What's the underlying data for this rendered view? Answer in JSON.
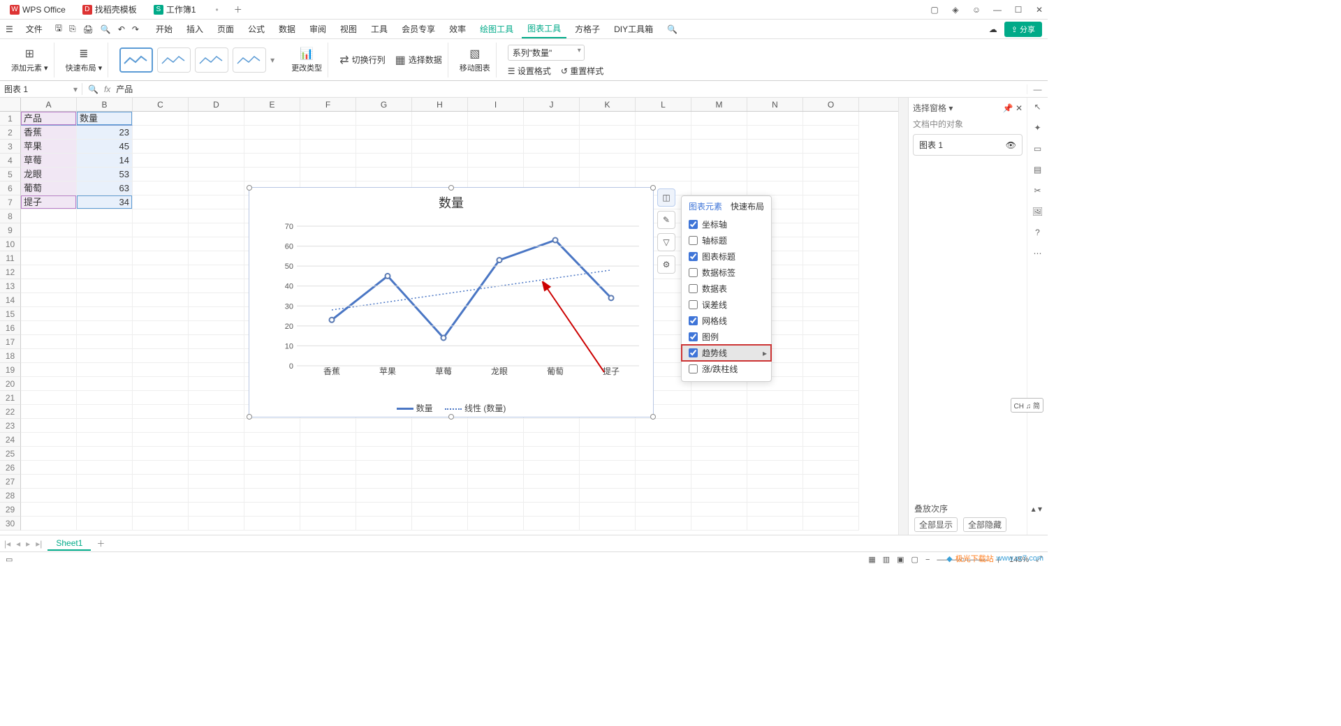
{
  "titlebar": {
    "tabs": [
      {
        "icon_bg": "#d33",
        "icon_txt": "W",
        "label": "WPS Office"
      },
      {
        "icon_bg": "#d33",
        "icon_txt": "D",
        "label": "找稻壳模板"
      },
      {
        "icon_bg": "#0a8",
        "icon_txt": "S",
        "label": "工作簿1"
      }
    ]
  },
  "menubar": {
    "file": "文件",
    "items": [
      "开始",
      "插入",
      "页面",
      "公式",
      "数据",
      "审阅",
      "视图",
      "工具",
      "会员专享",
      "效率",
      "绘图工具",
      "图表工具",
      "方格子",
      "DIY工具箱"
    ],
    "active": "图表工具",
    "green_extra": "绘图工具",
    "share": "分享"
  },
  "ribbon": {
    "add_element": "添加元素",
    "quick_layout": "快速布局",
    "change_type": "更改类型",
    "switch_rc": "切换行列",
    "select_data": "选择数据",
    "move_chart": "移动图表",
    "series_label": "系列\"数量\"",
    "set_format": "设置格式",
    "reset_style": "重置样式"
  },
  "namebox": "图表 1",
  "formula": "产品",
  "columns": [
    "A",
    "B",
    "C",
    "D",
    "E",
    "F",
    "G",
    "H",
    "I",
    "J",
    "K",
    "L",
    "M",
    "N",
    "O"
  ],
  "data": {
    "headers": [
      "产品",
      "数量"
    ],
    "rows": [
      [
        "香蕉",
        23
      ],
      [
        "苹果",
        45
      ],
      [
        "草莓",
        14
      ],
      [
        "龙眼",
        53
      ],
      [
        "葡萄",
        63
      ],
      [
        "提子",
        34
      ]
    ]
  },
  "chart_data": {
    "type": "line",
    "title": "数量",
    "categories": [
      "香蕉",
      "苹果",
      "草莓",
      "龙眼",
      "葡萄",
      "提子"
    ],
    "series": [
      {
        "name": "数量",
        "values": [
          23,
          45,
          14,
          53,
          63,
          34
        ],
        "style": "solid"
      },
      {
        "name": "线性 (数量)",
        "values": [
          28,
          32,
          36,
          40,
          44,
          48
        ],
        "style": "dotted",
        "is_trendline": true
      }
    ],
    "ylim": [
      0,
      70
    ],
    "ytick": 10,
    "legend": {
      "series": "数量",
      "trend": "线性 (数量)"
    }
  },
  "popup": {
    "tab_elements": "图表元素",
    "tab_layout": "快速布局",
    "items": [
      {
        "label": "坐标轴",
        "checked": true
      },
      {
        "label": "轴标题",
        "checked": false
      },
      {
        "label": "图表标题",
        "checked": true
      },
      {
        "label": "数据标签",
        "checked": false
      },
      {
        "label": "数据表",
        "checked": false
      },
      {
        "label": "误差线",
        "checked": false
      },
      {
        "label": "网格线",
        "checked": true
      },
      {
        "label": "图例",
        "checked": true
      },
      {
        "label": "趋势线",
        "checked": true,
        "highlight": true
      },
      {
        "label": "涨/跌柱线",
        "checked": false
      }
    ]
  },
  "rightpanel": {
    "title": "选择窗格",
    "subtitle": "文档中的对象",
    "object": "图表 1",
    "stack_label": "叠放次序",
    "show_all": "全部显示",
    "hide_all": "全部隐藏"
  },
  "sheettab": "Sheet1",
  "status": {
    "zoom": "145%",
    "ime": "CH ♫ 简"
  },
  "watermark": {
    "brand": "极光下载站",
    "url": "www.xz7.com"
  }
}
